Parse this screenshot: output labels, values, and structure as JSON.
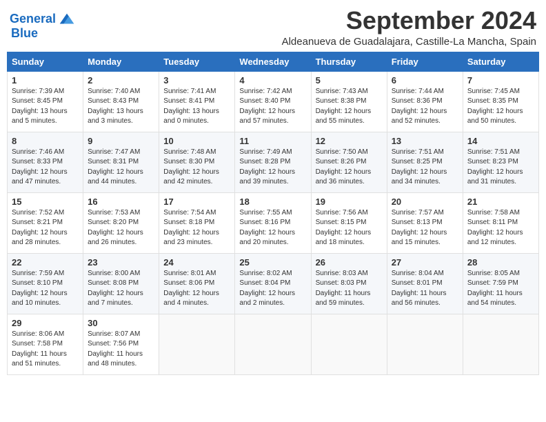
{
  "header": {
    "logo_line1": "General",
    "logo_line2": "Blue",
    "month": "September 2024",
    "location": "Aldeanueva de Guadalajara, Castille-La Mancha, Spain"
  },
  "weekdays": [
    "Sunday",
    "Monday",
    "Tuesday",
    "Wednesday",
    "Thursday",
    "Friday",
    "Saturday"
  ],
  "weeks": [
    [
      {
        "day": "1",
        "info": "Sunrise: 7:39 AM\nSunset: 8:45 PM\nDaylight: 13 hours\nand 5 minutes."
      },
      {
        "day": "2",
        "info": "Sunrise: 7:40 AM\nSunset: 8:43 PM\nDaylight: 13 hours\nand 3 minutes."
      },
      {
        "day": "3",
        "info": "Sunrise: 7:41 AM\nSunset: 8:41 PM\nDaylight: 13 hours\nand 0 minutes."
      },
      {
        "day": "4",
        "info": "Sunrise: 7:42 AM\nSunset: 8:40 PM\nDaylight: 12 hours\nand 57 minutes."
      },
      {
        "day": "5",
        "info": "Sunrise: 7:43 AM\nSunset: 8:38 PM\nDaylight: 12 hours\nand 55 minutes."
      },
      {
        "day": "6",
        "info": "Sunrise: 7:44 AM\nSunset: 8:36 PM\nDaylight: 12 hours\nand 52 minutes."
      },
      {
        "day": "7",
        "info": "Sunrise: 7:45 AM\nSunset: 8:35 PM\nDaylight: 12 hours\nand 50 minutes."
      }
    ],
    [
      {
        "day": "8",
        "info": "Sunrise: 7:46 AM\nSunset: 8:33 PM\nDaylight: 12 hours\nand 47 minutes."
      },
      {
        "day": "9",
        "info": "Sunrise: 7:47 AM\nSunset: 8:31 PM\nDaylight: 12 hours\nand 44 minutes."
      },
      {
        "day": "10",
        "info": "Sunrise: 7:48 AM\nSunset: 8:30 PM\nDaylight: 12 hours\nand 42 minutes."
      },
      {
        "day": "11",
        "info": "Sunrise: 7:49 AM\nSunset: 8:28 PM\nDaylight: 12 hours\nand 39 minutes."
      },
      {
        "day": "12",
        "info": "Sunrise: 7:50 AM\nSunset: 8:26 PM\nDaylight: 12 hours\nand 36 minutes."
      },
      {
        "day": "13",
        "info": "Sunrise: 7:51 AM\nSunset: 8:25 PM\nDaylight: 12 hours\nand 34 minutes."
      },
      {
        "day": "14",
        "info": "Sunrise: 7:51 AM\nSunset: 8:23 PM\nDaylight: 12 hours\nand 31 minutes."
      }
    ],
    [
      {
        "day": "15",
        "info": "Sunrise: 7:52 AM\nSunset: 8:21 PM\nDaylight: 12 hours\nand 28 minutes."
      },
      {
        "day": "16",
        "info": "Sunrise: 7:53 AM\nSunset: 8:20 PM\nDaylight: 12 hours\nand 26 minutes."
      },
      {
        "day": "17",
        "info": "Sunrise: 7:54 AM\nSunset: 8:18 PM\nDaylight: 12 hours\nand 23 minutes."
      },
      {
        "day": "18",
        "info": "Sunrise: 7:55 AM\nSunset: 8:16 PM\nDaylight: 12 hours\nand 20 minutes."
      },
      {
        "day": "19",
        "info": "Sunrise: 7:56 AM\nSunset: 8:15 PM\nDaylight: 12 hours\nand 18 minutes."
      },
      {
        "day": "20",
        "info": "Sunrise: 7:57 AM\nSunset: 8:13 PM\nDaylight: 12 hours\nand 15 minutes."
      },
      {
        "day": "21",
        "info": "Sunrise: 7:58 AM\nSunset: 8:11 PM\nDaylight: 12 hours\nand 12 minutes."
      }
    ],
    [
      {
        "day": "22",
        "info": "Sunrise: 7:59 AM\nSunset: 8:10 PM\nDaylight: 12 hours\nand 10 minutes."
      },
      {
        "day": "23",
        "info": "Sunrise: 8:00 AM\nSunset: 8:08 PM\nDaylight: 12 hours\nand 7 minutes."
      },
      {
        "day": "24",
        "info": "Sunrise: 8:01 AM\nSunset: 8:06 PM\nDaylight: 12 hours\nand 4 minutes."
      },
      {
        "day": "25",
        "info": "Sunrise: 8:02 AM\nSunset: 8:04 PM\nDaylight: 12 hours\nand 2 minutes."
      },
      {
        "day": "26",
        "info": "Sunrise: 8:03 AM\nSunset: 8:03 PM\nDaylight: 11 hours\nand 59 minutes."
      },
      {
        "day": "27",
        "info": "Sunrise: 8:04 AM\nSunset: 8:01 PM\nDaylight: 11 hours\nand 56 minutes."
      },
      {
        "day": "28",
        "info": "Sunrise: 8:05 AM\nSunset: 7:59 PM\nDaylight: 11 hours\nand 54 minutes."
      }
    ],
    [
      {
        "day": "29",
        "info": "Sunrise: 8:06 AM\nSunset: 7:58 PM\nDaylight: 11 hours\nand 51 minutes."
      },
      {
        "day": "30",
        "info": "Sunrise: 8:07 AM\nSunset: 7:56 PM\nDaylight: 11 hours\nand 48 minutes."
      },
      {
        "day": "",
        "info": ""
      },
      {
        "day": "",
        "info": ""
      },
      {
        "day": "",
        "info": ""
      },
      {
        "day": "",
        "info": ""
      },
      {
        "day": "",
        "info": ""
      }
    ]
  ]
}
